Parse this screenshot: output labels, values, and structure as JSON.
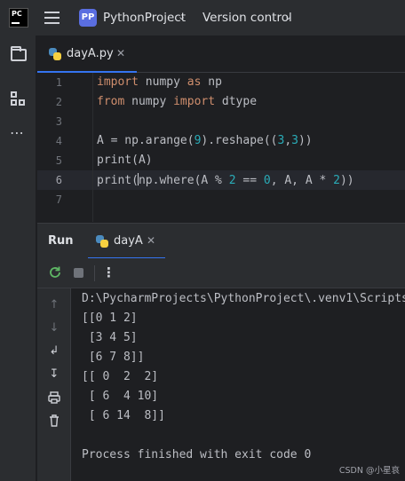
{
  "titlebar": {
    "logo_text": "PC",
    "project_badge": "PP",
    "project_name": "PythonProject",
    "vcs_label": "Version control"
  },
  "toolstrip": {
    "icons": [
      "folder-icon",
      "structure-icon",
      "more-icon"
    ]
  },
  "editor": {
    "tab_label": "dayA.py",
    "line_numbers": [
      "1",
      "2",
      "3",
      "4",
      "5",
      "6",
      "7"
    ],
    "current_line": "6"
  },
  "run": {
    "title": "Run",
    "tab_label": "dayA",
    "console_lines": [
      "D:\\PycharmProjects\\PythonProject\\.venv1\\Scripts",
      "[[0 1 2]",
      " [3 4 5]",
      " [6 7 8]]",
      "[[ 0  2  2]",
      " [ 6  4 10]",
      " [ 6 14  8]]",
      "",
      "Process finished with exit code 0"
    ]
  },
  "watermark": "CSDN @小星哀",
  "colors": {
    "accent": "#3574f0",
    "keyword": "#cf8e6d",
    "number": "#2aacb8",
    "background": "#1e1f22",
    "panel": "#2b2d30"
  }
}
